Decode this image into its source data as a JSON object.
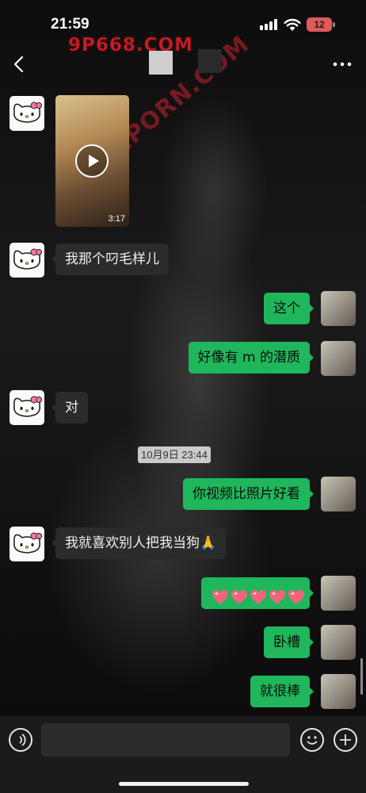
{
  "status_bar": {
    "time": "21:59",
    "battery": "12"
  },
  "watermark": {
    "brand": "9P668.COM",
    "diagonal": "91PORN.COM"
  },
  "nav": {
    "back_icon": "chevron-left-icon",
    "more_icon": "ellipsis-icon"
  },
  "messages": [
    {
      "side": "left",
      "type": "video",
      "duration": "3:17"
    },
    {
      "side": "left",
      "type": "text",
      "text": "我那个叼毛样儿"
    },
    {
      "side": "right",
      "type": "text",
      "text": "这个"
    },
    {
      "side": "right",
      "type": "text",
      "text": "好像有 m 的潜质"
    },
    {
      "side": "left",
      "type": "text",
      "text": "对"
    },
    {
      "type": "timestamp",
      "text": "10月9日 23:44"
    },
    {
      "side": "right",
      "type": "text",
      "text": "你视频比照片好看"
    },
    {
      "side": "left",
      "type": "text",
      "text": "我就喜欢别人把我当狗🙏"
    },
    {
      "side": "right",
      "type": "emoji",
      "emoji": "heart",
      "count": 5
    },
    {
      "side": "right",
      "type": "text",
      "text": "卧槽"
    },
    {
      "side": "right",
      "type": "text",
      "text": "就很棒"
    }
  ],
  "colors": {
    "sent_bubble": "#1fb65c",
    "received_bubble": "#2b2b2b",
    "battery": "#e05a5a",
    "watermark": "#c81f2b"
  },
  "input": {
    "value": "",
    "voice_icon": "voice-icon",
    "emoji_icon": "emoji-icon",
    "plus_icon": "plus-icon"
  }
}
